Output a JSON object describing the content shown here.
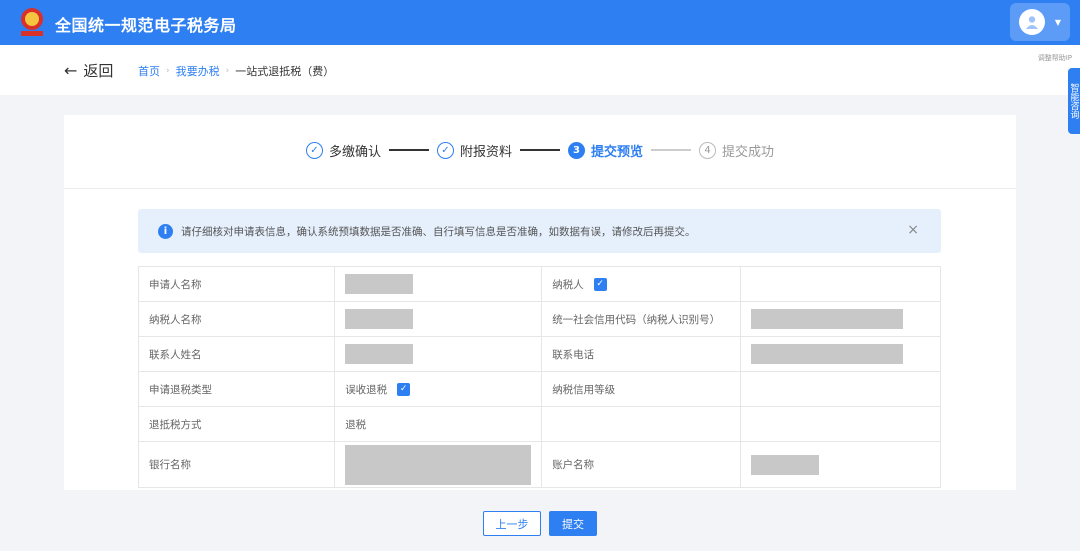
{
  "header": {
    "title": "全国统一规范电子税务局"
  },
  "nav": {
    "back_label": "返回",
    "breadcrumb": [
      "首页",
      "我要办税",
      "一站式退抵税（费）"
    ],
    "side_tab_label": "智能咨询",
    "help_mini": "调整帮助IP"
  },
  "steps": [
    {
      "index": "1",
      "label": "多缴确认",
      "state": "done"
    },
    {
      "index": "2",
      "label": "附报资料",
      "state": "done"
    },
    {
      "index": "3",
      "label": "提交预览",
      "state": "active"
    },
    {
      "index": "4",
      "label": "提交成功",
      "state": "todo"
    }
  ],
  "notice": {
    "text": "请仔细核对申请表信息，确认系统预填数据是否准确、自行填写信息是否准确，如数据有误，请修改后再提交。"
  },
  "form": {
    "applicant_name_label": "申请人名称",
    "taxpayer_checkbox_label": "纳税人",
    "taxpayer_name_label": "纳税人名称",
    "credit_code_label": "统一社会信用代码（纳税人识别号）",
    "contact_name_label": "联系人姓名",
    "phone_label": "联系电话",
    "refund_type_label": "申请退税类型",
    "refund_type_value": "误收退税",
    "credit_rating_label": "纳税信用等级",
    "refund_method_label": "退抵税方式",
    "refund_method_value": "退税",
    "bank_name_label": "银行名称",
    "account_name_label": "账户名称"
  },
  "footer": {
    "prev_label": "上一步",
    "submit_label": "提交"
  },
  "colors": {
    "primary": "#2e7ff2",
    "notice_bg": "#e6f0fd",
    "redacted": "#c8c8c8"
  },
  "icons": {
    "check": "✓",
    "close": "×",
    "info": "i",
    "back": "←"
  }
}
